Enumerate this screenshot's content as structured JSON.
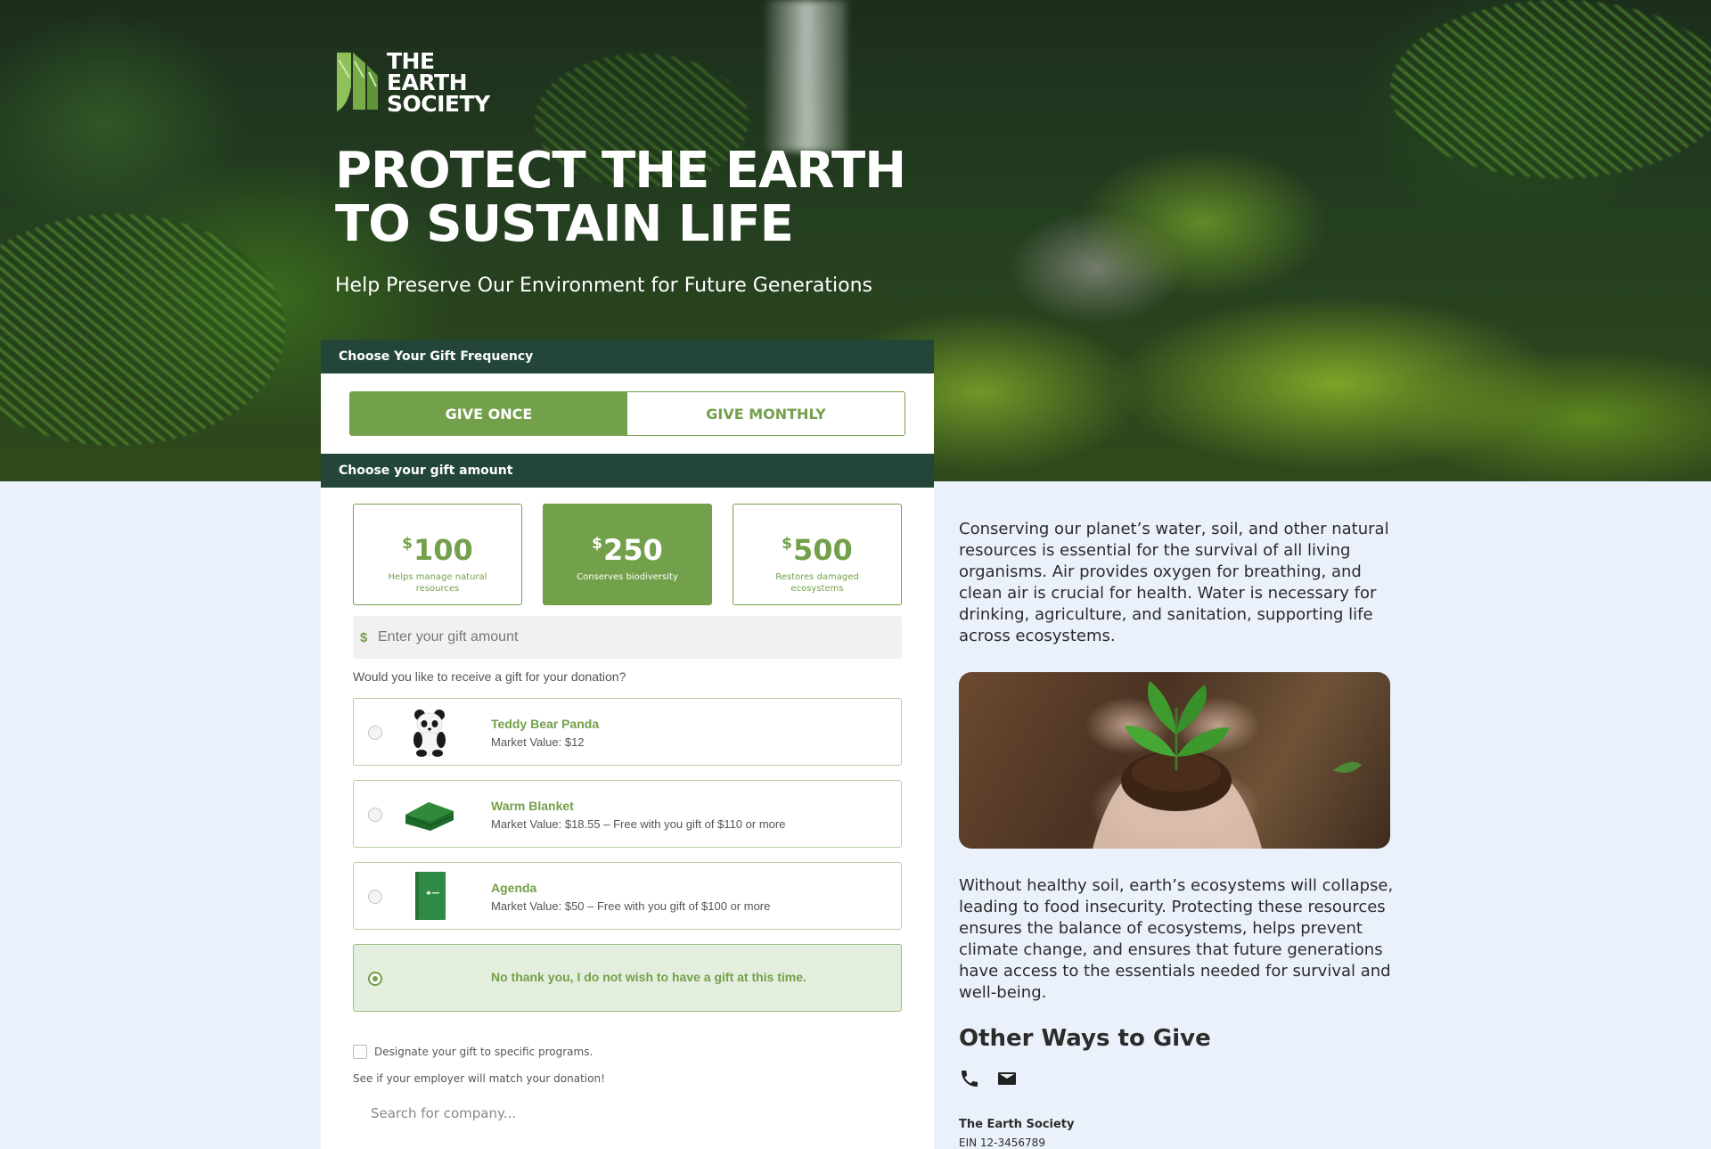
{
  "brand": {
    "logo_line1": "THE",
    "logo_line2": "EARTH",
    "logo_line3": "SOCIETY",
    "accent_color": "#73a04a",
    "header_color": "#234638"
  },
  "hero": {
    "title_line1": "PROTECT THE EARTH",
    "title_line2": "TO SUSTAIN LIFE",
    "subtitle": "Help Preserve Our Environment for Future Generations"
  },
  "frequency": {
    "header": "Choose Your Gift Frequency",
    "options": [
      "GIVE ONCE",
      "GIVE MONTHLY"
    ],
    "selected": "GIVE ONCE"
  },
  "amount": {
    "header": "Choose your gift amount",
    "currency_symbol": "$",
    "cards": [
      {
        "value": "100",
        "desc": "Helps manage natural resources",
        "selected": false
      },
      {
        "value": "250",
        "desc": "Conserves biodiversity",
        "selected": true
      },
      {
        "value": "500",
        "desc": "Restores damaged ecosystems",
        "selected": false
      }
    ],
    "custom_placeholder": "Enter your gift amount"
  },
  "gifts": {
    "question": "Would you like to receive a gift for your donation?",
    "options": [
      {
        "name": "Teddy Bear Panda",
        "value": "Market Value: $12",
        "icon": "panda-plush-icon",
        "selected": false
      },
      {
        "name": "Warm Blanket",
        "value": "Market Value: $18.55 – Free with you gift of $110 or more",
        "icon": "blanket-icon",
        "selected": false
      },
      {
        "name": "Agenda",
        "value": "Market Value: $50 – Free with you gift of $100 or more",
        "icon": "agenda-book-icon",
        "selected": false
      },
      {
        "name": "No thank you, I do not wish to have a gift at this time.",
        "value": "",
        "icon": "",
        "selected": true
      }
    ]
  },
  "designate_label": "Designate your gift to specific programs.",
  "employer_match_text": "See if your employer will match your donation!",
  "company_search_placeholder": "Search for company...",
  "content": {
    "paragraph1": "Conserving our planet’s water, soil, and other natural resources is essential for the survival of all living organisms. Air provides oxygen for breathing, and clean air is crucial for health. Water is necessary for drinking, agriculture, and sanitation, supporting life across ecosystems.",
    "paragraph2": "Without healthy soil, earth’s ecosystems will collapse, leading to food insecurity. Protecting these resources ensures the balance of ecosystems, helps prevent climate change, and ensures that future generations have access to the essentials needed for survival and well-being.",
    "other_ways_title": "Other Ways to Give",
    "contact_icons": [
      "phone-icon",
      "envelope-icon"
    ],
    "org_name": "The Earth Society",
    "org_ein": "EIN 12-3456789"
  }
}
